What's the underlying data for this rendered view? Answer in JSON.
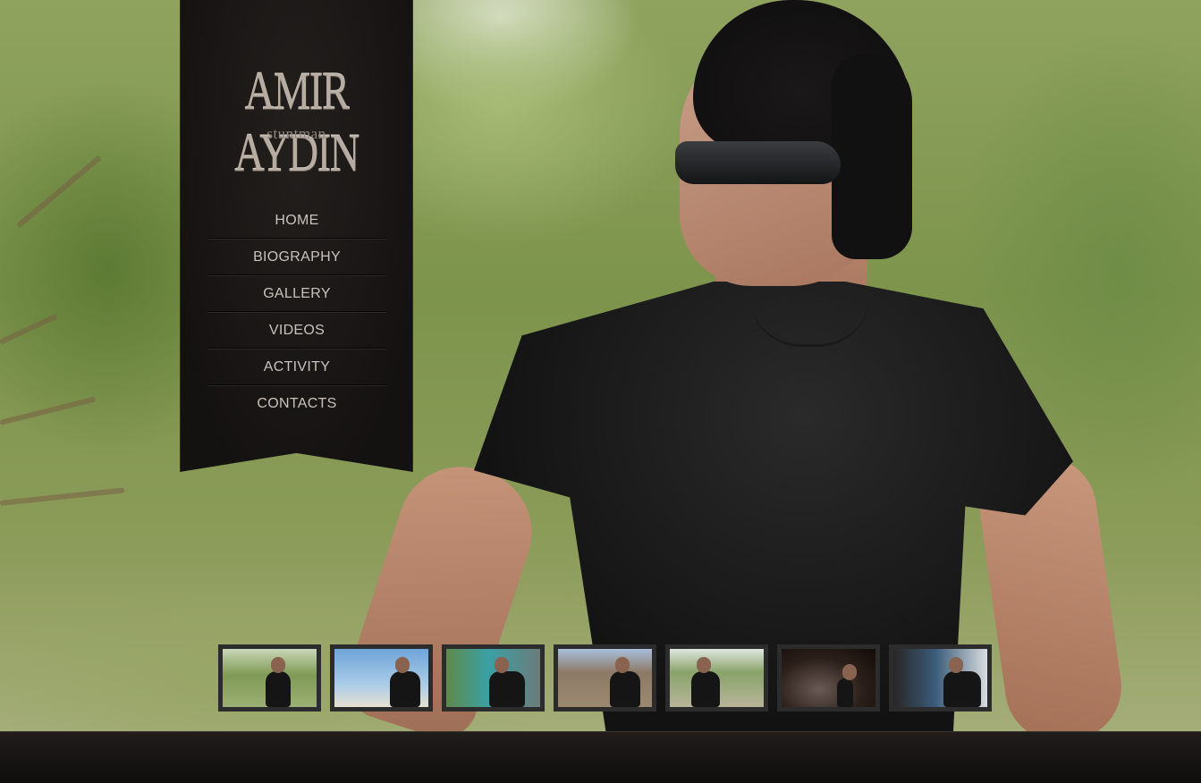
{
  "site": {
    "name": "AMIR AYDIN",
    "tagline": "stuntman"
  },
  "nav": {
    "items": [
      {
        "label": "HOME"
      },
      {
        "label": "BIOGRAPHY"
      },
      {
        "label": "GALLERY"
      },
      {
        "label": "VIDEOS"
      },
      {
        "label": "ACTIVITY"
      },
      {
        "label": "CONTACTS"
      }
    ]
  },
  "gallery": {
    "thumbnail_count": 7
  },
  "colors": {
    "sidebar": "#171412",
    "nav_text": "#c9c2bc",
    "thumb_border": "#2c2c2c",
    "footer": "#151311"
  }
}
